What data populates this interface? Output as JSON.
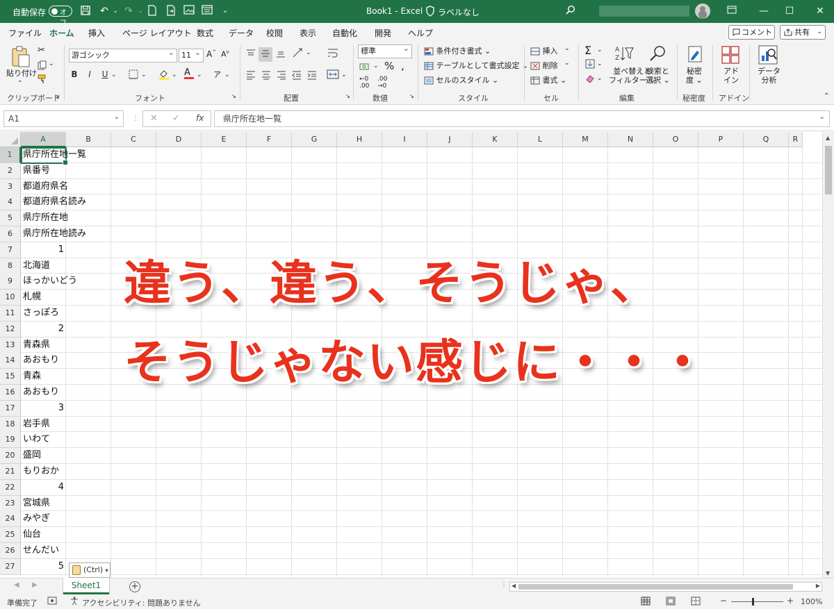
{
  "titlebar": {
    "autosave_label": "自動保存",
    "autosave_state": "オフ",
    "doc_title": "Book1 - Excel",
    "sensitivity_label": "ラベルなし"
  },
  "ribbon_tabs": [
    "ファイル",
    "ホーム",
    "挿入",
    "ページ レイアウト",
    "数式",
    "データ",
    "校閲",
    "表示",
    "自動化",
    "開発",
    "ヘルプ"
  ],
  "active_tab": "ホーム",
  "actions": {
    "comment": "コメント",
    "share": "共有"
  },
  "ribbon": {
    "clipboard": {
      "paste": "貼り付け",
      "group": "クリップボード"
    },
    "font": {
      "name": "游ゴシック",
      "size": "11",
      "group": "フォント",
      "bold": "B",
      "italic": "I",
      "underline": "U"
    },
    "alignment": {
      "group": "配置"
    },
    "number": {
      "format": "標準",
      "group": "数値"
    },
    "styles": {
      "conditional": "条件付き書式",
      "table": "テーブルとして書式設定",
      "cell_style": "セルのスタイル",
      "group": "スタイル"
    },
    "cells": {
      "insert": "挿入",
      "delete": "削除",
      "format": "書式",
      "group": "セル"
    },
    "editing": {
      "sort": "並べ替えと\nフィルター",
      "sort_l1": "並べ替えと",
      "sort_l2": "フィルター",
      "find_l1": "検索と",
      "find_l2": "選択",
      "group": "編集"
    },
    "sensitivity": {
      "l1": "秘密",
      "l2": "度",
      "group": "秘密度"
    },
    "addins": {
      "l1": "アド",
      "l2": "イン",
      "group": "アドイン"
    },
    "analysis": {
      "l1": "データ",
      "l2": "分析"
    }
  },
  "formula_bar": {
    "name_box": "A1",
    "fx": "fx",
    "formula": "県庁所在地一覧"
  },
  "columns": [
    "A",
    "B",
    "C",
    "D",
    "E",
    "F",
    "G",
    "H",
    "I",
    "J",
    "K",
    "L",
    "M",
    "N",
    "O",
    "P",
    "Q",
    "R"
  ],
  "rows": [
    "1",
    "2",
    "3",
    "4",
    "5",
    "6",
    "7",
    "8",
    "9",
    "10",
    "11",
    "12",
    "13",
    "14",
    "15",
    "16",
    "17",
    "18",
    "19",
    "20",
    "21",
    "22",
    "23",
    "24",
    "25",
    "26",
    "27"
  ],
  "cells": [
    "県庁所在地一覧",
    "県番号",
    "都道府県名",
    "都道府県名読み",
    "県庁所在地",
    "県庁所在地読み",
    "1",
    "北海道",
    "ほっかいどう",
    "札幌",
    "さっぽろ",
    "2",
    "青森県",
    "あおもり",
    "青森",
    "あおもり",
    "3",
    "岩手県",
    "いわて",
    "盛岡",
    "もりおか",
    "4",
    "宮城県",
    "みやぎ",
    "仙台",
    "せんだい",
    "5"
  ],
  "overlay": {
    "line1": "違う、違う、そうじゃ、",
    "line2": "そうじゃない感じに・・・"
  },
  "paste_options": "(Ctrl)",
  "sheet_tab": "Sheet1",
  "status": {
    "ready": "準備完了",
    "accessibility": "アクセシビリティ: 問題ありません",
    "zoom": "100%"
  }
}
